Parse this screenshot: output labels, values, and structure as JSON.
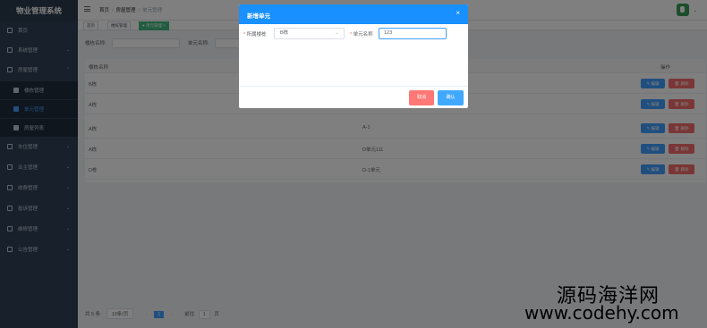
{
  "app": {
    "title": "物业管理系统"
  },
  "sidebar": {
    "items": [
      {
        "label": "首页",
        "icon": "home-icon"
      },
      {
        "label": "系统管理",
        "icon": "grid-icon",
        "arrow": "⌄"
      },
      {
        "label": "房屋管理",
        "icon": "gear-icon",
        "arrow": "⌃"
      },
      {
        "label": "楼栋管理",
        "icon": "grid-icon"
      },
      {
        "label": "单元管理",
        "icon": "grid-icon"
      },
      {
        "label": "房屋列表",
        "icon": "doc-icon"
      },
      {
        "label": "车位管理",
        "icon": "car-icon",
        "arrow": "⌄"
      },
      {
        "label": "业主管理",
        "icon": "user-icon",
        "arrow": "⌄"
      },
      {
        "label": "收费管理",
        "icon": "money-icon",
        "arrow": "⌄"
      },
      {
        "label": "投诉管理",
        "icon": "complaint-icon",
        "arrow": "⌄"
      },
      {
        "label": "维修管理",
        "icon": "repair-icon",
        "arrow": "⌄"
      },
      {
        "label": "公告管理",
        "icon": "notice-icon",
        "arrow": "⌄"
      }
    ]
  },
  "navbar": {
    "breadcrumb": [
      "首页",
      "房屋管理",
      "单元管理"
    ],
    "separator": "/",
    "avatar_caret": "⌄"
  },
  "tags": {
    "items": [
      "首页",
      "楼栋管理",
      "● 单元管理 ×"
    ]
  },
  "search": {
    "building_label": "楼栋名称:",
    "unit_label": "单元名称:"
  },
  "table": {
    "headers": [
      "楼栋名称",
      "操作"
    ],
    "rows": [
      {
        "building": "B栋",
        "unit": ""
      },
      {
        "building": "A栋",
        "unit": ""
      },
      {
        "building": "A栋",
        "unit": "A-1"
      },
      {
        "building": "A栋",
        "unit": "D单元111"
      },
      {
        "building": "D栋",
        "unit": "D-1单元"
      }
    ],
    "edit_label": "✎ 编辑",
    "delete_label": "🗑 删除"
  },
  "pagination": {
    "total": "共 5 条",
    "page_size": "10条/页",
    "prev": "‹",
    "current_page": "1",
    "next": "›",
    "goto_label": "前往",
    "goto_value": "1",
    "page_suffix": "页"
  },
  "dialog": {
    "title": "新增单元",
    "close": "×",
    "building_label": "所属楼栋",
    "building_value": "B栋",
    "unit_label": "单元名称",
    "unit_value": "123",
    "required_mark": "*",
    "cancel_label": "取消",
    "ok_label": "确认"
  },
  "watermark": {
    "line1": "源码海洋网",
    "line2": "www.codehy.com"
  },
  "colors": {
    "sidebar_bg": "#304156",
    "dialog_header": "#1890ff",
    "edit_btn": "#409eff",
    "delete_btn": "#f56c6c",
    "active_tag": "#42b983"
  }
}
